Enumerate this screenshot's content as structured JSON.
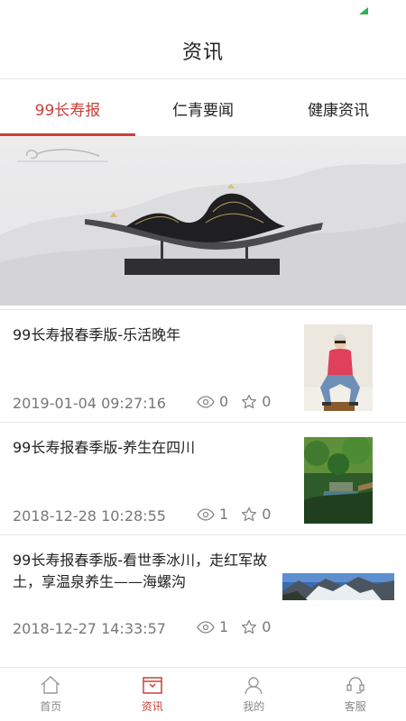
{
  "status": {
    "signal_icon": "signal-icon",
    "accent": "#2bb24c"
  },
  "header": {
    "title": "资讯"
  },
  "tabs": [
    {
      "label": "99长寿报",
      "active": true
    },
    {
      "label": "仁青要闻",
      "active": false
    },
    {
      "label": "健康资讯",
      "active": false
    }
  ],
  "banner": {
    "image": "mountain-sculpture-banner"
  },
  "news": [
    {
      "title": "99长寿报春季版-乐活晚年",
      "date": "2019-01-04 09:27:16",
      "views": "0",
      "stars": "0"
    },
    {
      "title": "99长寿报春季版-养生在四川",
      "date": "2018-12-28 10:28:55",
      "views": "1",
      "stars": "0"
    },
    {
      "title": "99长寿报春季版-看世季冰川，走红军故土，享温泉养生——海螺沟",
      "date": "2018-12-27 14:33:57",
      "views": "1",
      "stars": "0"
    }
  ],
  "tabbar": [
    {
      "label": "首页",
      "icon": "home-icon",
      "active": false
    },
    {
      "label": "资讯",
      "icon": "news-icon",
      "active": true
    },
    {
      "label": "我的",
      "icon": "user-icon",
      "active": false
    },
    {
      "label": "客服",
      "icon": "service-icon",
      "active": false
    }
  ],
  "colors": {
    "accent": "#c9403a",
    "divider": "#e6e6e6",
    "meta_text": "#777777"
  }
}
